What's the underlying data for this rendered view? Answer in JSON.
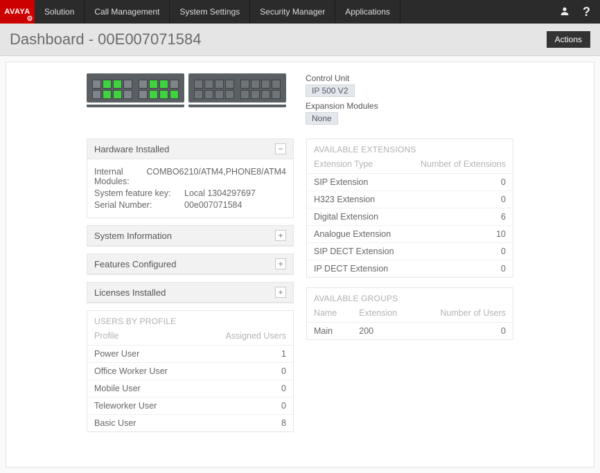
{
  "brand": "AVAYA",
  "nav": [
    "Solution",
    "Call Management",
    "System Settings",
    "Security Manager",
    "Applications"
  ],
  "page_title": "Dashboard - 00E007071584",
  "actions_label": "Actions",
  "unit": {
    "control_unit_label": "Control Unit",
    "control_unit_value": "IP 500 V2",
    "expansion_label": "Expansion Modules",
    "expansion_value": "None"
  },
  "hardware": {
    "title": "Hardware Installed",
    "rows": [
      {
        "k": "Internal Modules:",
        "v": "COMBO6210/ATM4,PHONE8/ATM4"
      },
      {
        "k": "System feature key:",
        "v": "Local 1304297697"
      },
      {
        "k": "Serial Number:",
        "v": "00e007071584"
      }
    ]
  },
  "collapsed_panels": [
    "System Information",
    "Features Configured",
    "Licenses Installed"
  ],
  "users_by_profile": {
    "title": "USERS BY PROFILE",
    "col1": "Profile",
    "col2": "Assigned Users",
    "rows": [
      {
        "p": "Power User",
        "n": "1"
      },
      {
        "p": "Office Worker User",
        "n": "0"
      },
      {
        "p": "Mobile User",
        "n": "0"
      },
      {
        "p": "Teleworker User",
        "n": "0"
      },
      {
        "p": "Basic User",
        "n": "8"
      }
    ]
  },
  "extensions": {
    "title": "AVAILABLE EXTENSIONS",
    "col1": "Extension Type",
    "col2": "Number of Extensions",
    "rows": [
      {
        "t": "SIP Extension",
        "n": "0"
      },
      {
        "t": "H323 Extension",
        "n": "0"
      },
      {
        "t": "Digital Extension",
        "n": "6"
      },
      {
        "t": "Analogue Extension",
        "n": "10"
      },
      {
        "t": "SIP DECT Extension",
        "n": "0"
      },
      {
        "t": "IP DECT Extension",
        "n": "0"
      }
    ]
  },
  "groups": {
    "title": "AVAILABLE GROUPS",
    "col1": "Name",
    "col2": "Extension",
    "col3": "Number of Users",
    "rows": [
      {
        "name": "Main",
        "ext": "200",
        "n": "0"
      }
    ]
  },
  "chassis": {
    "left": [
      [
        0,
        1,
        1,
        0,
        0,
        1,
        1,
        0
      ],
      [
        0,
        1,
        1,
        0,
        0,
        1,
        1,
        1
      ]
    ]
  }
}
